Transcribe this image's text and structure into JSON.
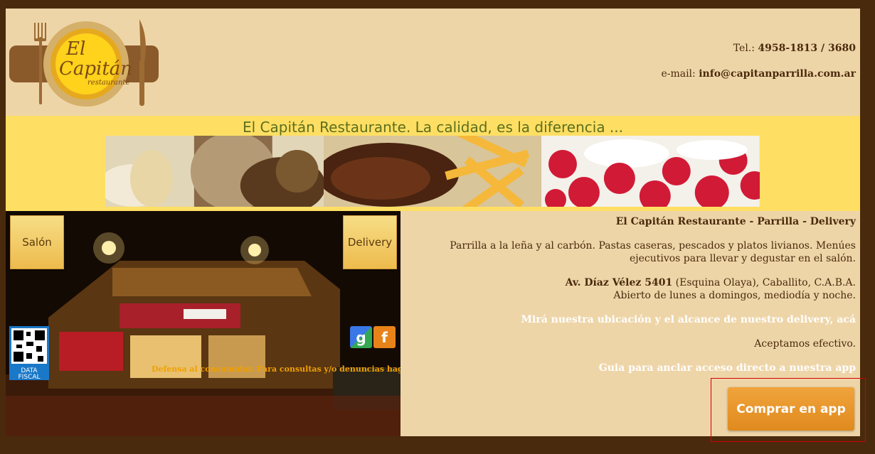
{
  "header": {
    "logo_text_top": "El",
    "logo_text_main": "Capitán",
    "logo_text_sub": "restaurante",
    "tel_label": "Tel.:",
    "tel_value": "4958-1813 / 3680",
    "email_label": "e-mail:",
    "email_value": "info@capitanparrilla.com.ar"
  },
  "banner": {
    "slogan": "El Capitán Restaurante.  La calidad, es la diferencia ..."
  },
  "left": {
    "salon_label": "Salón",
    "delivery_label": "Delivery",
    "defensa_text": "Defensa al consumidor. Para consultas y/o denuncias haga clic aquí",
    "qr_caption_1": "DATA",
    "qr_caption_2": "FISCAL",
    "google_icon": "g",
    "facebook_icon": "f"
  },
  "right": {
    "title": "El Capitán Restaurante - Parrilla - Delivery",
    "description": "Parrilla a la leña y al carbón. Pastas caseras, pescados y platos livianos. Menúes ejecutivos para llevar y degustar en el salón.",
    "address_bold": "Av. Díaz Vélez 5401",
    "address_rest": " (Esquina Olaya), Caballito, C.A.B.A.",
    "hours": "Abierto de lunes a domingos, mediodía y noche.",
    "location_link": "Mirá nuestra ubicación y el alcance de nuestro delivery, acá",
    "payment": "Aceptamos efectivo.",
    "guide_link": "Guia para anclar acceso directo a nuestra app",
    "buy_button": "Comprar en app"
  },
  "colors": {
    "background": "#4a2a0c",
    "header_bg": "#eed5a8",
    "banner_bg": "#ffdf63",
    "button_orange": "#e8952c",
    "highlight_red": "#d40000"
  }
}
